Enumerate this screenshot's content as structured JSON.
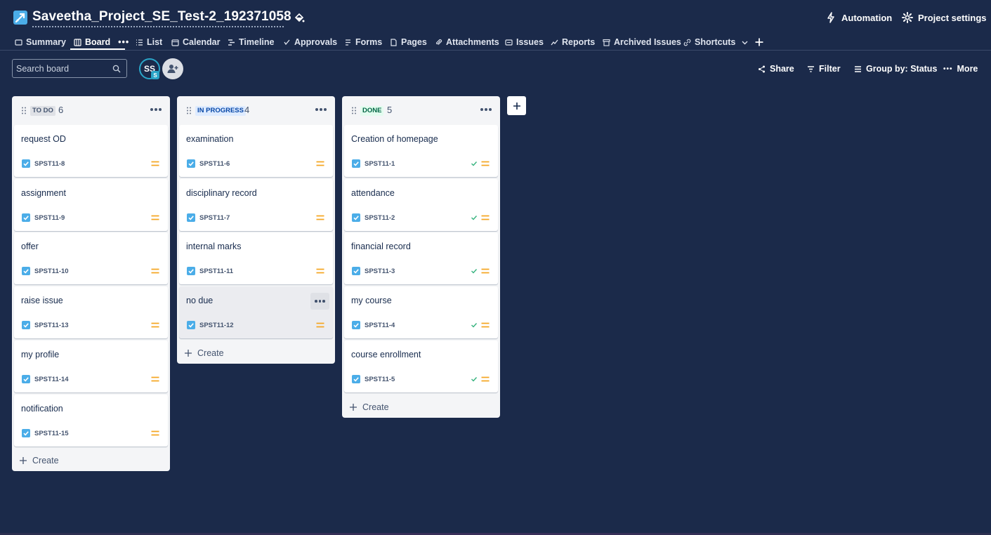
{
  "header": {
    "project_title": "Saveetha_Project_SE_Test-2_192371058",
    "automation_label": "Automation",
    "settings_label": "Project settings"
  },
  "tabs": [
    {
      "label": "Summary",
      "icon": "summary-icon"
    },
    {
      "label": "Board",
      "icon": "board-icon",
      "active": true
    },
    {
      "label": "List",
      "icon": "list-icon"
    },
    {
      "label": "Calendar",
      "icon": "calendar-icon"
    },
    {
      "label": "Timeline",
      "icon": "timeline-icon"
    },
    {
      "label": "Approvals",
      "icon": "approvals-icon"
    },
    {
      "label": "Forms",
      "icon": "forms-icon"
    },
    {
      "label": "Pages",
      "icon": "pages-icon"
    },
    {
      "label": "Attachments",
      "icon": "attachment-icon"
    },
    {
      "label": "Issues",
      "icon": "issues-icon"
    },
    {
      "label": "Reports",
      "icon": "reports-icon"
    },
    {
      "label": "Archived Issues",
      "icon": "archive-icon"
    },
    {
      "label": "Shortcuts",
      "icon": "link-icon"
    }
  ],
  "toolbar": {
    "search_placeholder": "Search board",
    "avatar_initials": "SS",
    "avatar_badge": "S",
    "share_label": "Share",
    "filter_label": "Filter",
    "group_label": "Group by: Status",
    "more_label": "More"
  },
  "columns": [
    {
      "status": "TO DO",
      "count": "6",
      "lozenge_bg": "#dfe1e6",
      "lozenge_fg": "#44546f",
      "cards": [
        {
          "title": "request OD",
          "key": "SPST11-8"
        },
        {
          "title": "assignment",
          "key": "SPST11-9"
        },
        {
          "title": "offer",
          "key": "SPST11-10"
        },
        {
          "title": "raise issue",
          "key": "SPST11-13"
        },
        {
          "title": "my profile",
          "key": "SPST11-14"
        },
        {
          "title": "notification",
          "key": "SPST11-15"
        }
      ],
      "create_label": "Create"
    },
    {
      "status": "IN PROGRESS",
      "count": "4",
      "lozenge_bg": "#deebff",
      "lozenge_fg": "#0747a6",
      "cards": [
        {
          "title": "examination",
          "key": "SPST11-6"
        },
        {
          "title": "disciplinary record",
          "key": "SPST11-7"
        },
        {
          "title": "internal marks",
          "key": "SPST11-11"
        },
        {
          "title": "no due",
          "key": "SPST11-12"
        }
      ],
      "create_label": "Create"
    },
    {
      "status": "DONE",
      "count": "5",
      "lozenge_bg": "#e3fcef",
      "lozenge_fg": "#006644",
      "cards": [
        {
          "title": "Creation of homepage",
          "key": "SPST11-1"
        },
        {
          "title": "attendance",
          "key": "SPST11-2"
        },
        {
          "title": "financial record",
          "key": "SPST11-3"
        },
        {
          "title": "my course",
          "key": "SPST11-4"
        },
        {
          "title": "course enrollment",
          "key": "SPST11-5"
        }
      ],
      "create_label": "Create"
    }
  ],
  "colors": {
    "background": "#1b2a4a",
    "priority_medium": "#f5a623",
    "checkbox": "#4bade8",
    "done_check": "#36b37e"
  }
}
